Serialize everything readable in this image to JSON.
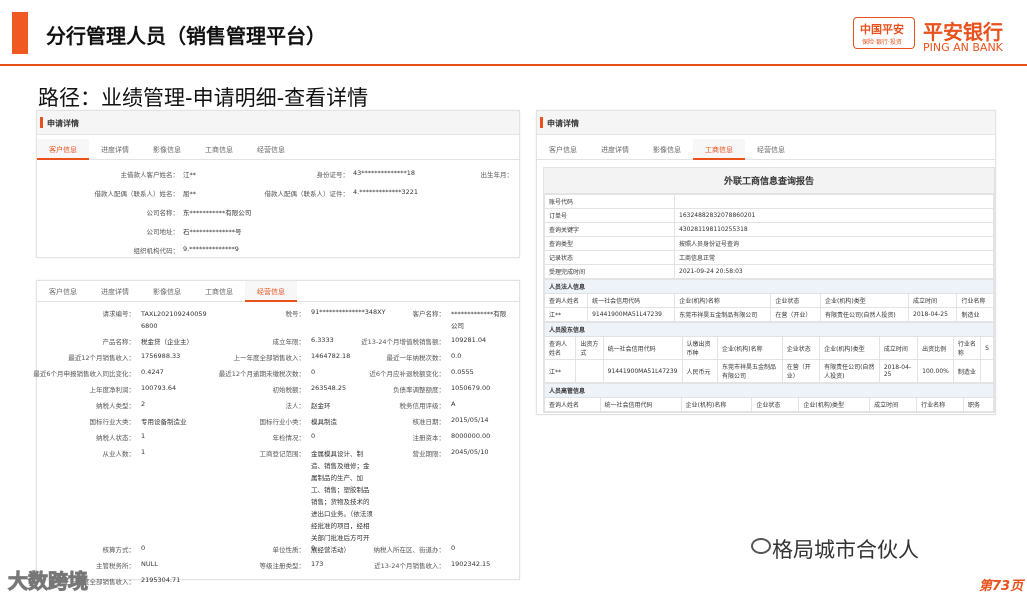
{
  "header": {
    "title": "分行管理人员（销售管理平台）",
    "logo": {
      "box_cn": "中国平安",
      "box_sub": "保险·银行·投资",
      "cn": "平安银行",
      "en": "PING AN BANK"
    }
  },
  "path": "路径：业绩管理-申请明细-查看详情",
  "panel1": {
    "head": "申请详情",
    "tabs": [
      "客户信息",
      "进度详情",
      "影像信息",
      "工商信息",
      "经营信息"
    ],
    "fields": [
      {
        "l": "主借款人客户姓名：",
        "v": "江**"
      },
      {
        "l": "身份证号：",
        "v": "43**************18"
      },
      {
        "l": "出生年月：",
        "v": ""
      },
      {
        "l": "借款人配偶（联系人）姓名：",
        "v": "屈**"
      },
      {
        "l": "借款人配偶（联系人）证件：",
        "v": "4.*************3221"
      },
      {
        "l": "公司名称：",
        "v": "东***********有限公司"
      },
      {
        "l": "公司地址：",
        "v": "石**************号"
      },
      {
        "l": "组织机构代码：",
        "v": "9.**************9"
      }
    ]
  },
  "panel2": {
    "tabs": [
      "客户信息",
      "进度详情",
      "影像信息",
      "工商信息",
      "经营信息"
    ],
    "rows": [
      [
        "请求编号：",
        "TAXL2021092400596800",
        "税号：",
        "91**************348XY",
        "客户名称：",
        "*************有限公司"
      ],
      [
        "产品名称：",
        "税金贷（企业主）",
        "成立年限：",
        "6.3333",
        "近13-24个月增值税销售额：",
        "109281.04"
      ],
      [
        "最近12个月销售收入：",
        "1756988.33",
        "上一年度全部销售收入：",
        "1464782.18",
        "最近一年纳税次数：",
        "0.0"
      ],
      [
        "最近6个月申报销售收入同比变化：",
        "0.4247",
        "最近12个月逾期未缴税次数：",
        "0",
        "近6个月应补退税额变化：",
        "0.0555"
      ],
      [
        "上年度净利润：",
        "100793.64",
        "初始税额：",
        "263548.25",
        "负债率调整额度：",
        "1050679.00"
      ],
      [
        "纳税人类型：",
        "2",
        "法人：",
        "赵金环",
        "税务信用评级：",
        "A"
      ],
      [
        "国标行业大类：",
        "专用设备制造业",
        "国标行业小类：",
        "模具制造",
        "核准日期：",
        "2015/05/14"
      ],
      [
        "纳税人状态：",
        "1",
        "年检情况：",
        "0",
        "注册资本：",
        "8000000.00"
      ],
      [
        "从业人数：",
        "1",
        "工商登记范围：",
        "金属模具设计、制造、销售及维修；金属制品的生产、加工、销售；塑胶制品销售；货物及技术的进出口业务。（依法须经批准的项目，经相关部门批准后方可开展经营活动）",
        "营业期限：",
        "2045/05/10"
      ],
      [
        "核算方式：",
        "0",
        "单位性质：",
        "0",
        "纳税人所在区、街道办：",
        "0"
      ],
      [
        "主管税务所：",
        "NULL",
        "等级注册类型：",
        "173",
        "近13-24个月销售收入：",
        "1902342.15"
      ],
      [
        "上上年度全部销售收入：",
        "2195304.71",
        "",
        "",
        "",
        ""
      ]
    ]
  },
  "panel3": {
    "head": "申请详情",
    "tabs": [
      "客户信息",
      "进度详情",
      "影像信息",
      "工商信息",
      "经营信息"
    ],
    "report_title": "外联工商信息查询报告",
    "meta": [
      [
        "账号代码",
        ""
      ],
      [
        "订单号",
        "16324882832078860201"
      ],
      [
        "查询关键字",
        "430281198110255318"
      ],
      [
        "查询类型",
        "按照人员身份证号查询"
      ],
      [
        "记录状态",
        "工商信息正常"
      ],
      [
        "受理完成时间",
        "2021-09-24 20:58:03"
      ]
    ],
    "sec1": "人员法人信息",
    "t1_head": [
      "查询人姓名",
      "统一社会信用代码",
      "企业(机构)名称",
      "企业状态",
      "企业(机构)类型",
      "成立时间",
      "行业名称"
    ],
    "t1_row": [
      "江**",
      "91441900MA51L47239",
      "东莞市祥昊五金制品有限公司",
      "在营（开业）",
      "有限责任公司(自然人投资)",
      "2018-04-25",
      "制造业"
    ],
    "sec2": "人员股东信息",
    "t2_head": [
      "查询人姓名",
      "出资方式",
      "统一社会信用代码",
      "认缴出资币种",
      "企业(机构)名称",
      "企业状态",
      "企业(机构)类型",
      "成立时间",
      "出资比例",
      "行业名称",
      "S"
    ],
    "t2_row": [
      "江**",
      "",
      "91441900MA51L47239",
      "人民币元",
      "东莞市祥昊五金制品有限公司",
      "在营（开业）",
      "有限责任公司(自然人投资)",
      "2018-04-25",
      "100.00%",
      "制造业",
      ""
    ],
    "sec3": "人员高管信息",
    "t3_head": [
      "查询人姓名",
      "统一社会信用代码",
      "企业(机构)名称",
      "企业状态",
      "企业(机构)类型",
      "成立时间",
      "行业名称",
      "职务"
    ]
  },
  "watermark": "格局城市合伙人",
  "brand_bl": "大数跨境",
  "page_no": "第73页"
}
